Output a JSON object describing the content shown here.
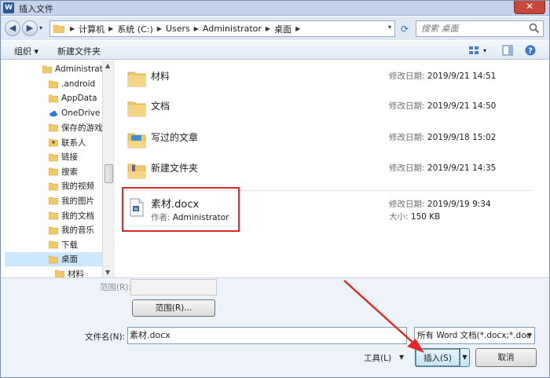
{
  "window": {
    "title": "插入文件",
    "app_icon_letter": "W",
    "close_glyph": "✕"
  },
  "address": {
    "crumbs": [
      "计算机",
      "系统 (C:)",
      "Users",
      "Administrator",
      "桌面"
    ],
    "search_placeholder": "搜索 桌面"
  },
  "toolbar": {
    "organize_label": "组织 ▾",
    "new_folder_label": "新建文件夹"
  },
  "nav": {
    "items": [
      {
        "label": "Administrato",
        "icon": "user-folder-icon"
      },
      {
        "label": ".android",
        "icon": "folder-icon"
      },
      {
        "label": "AppData",
        "icon": "folder-icon"
      },
      {
        "label": "OneDrive",
        "icon": "cloud-icon"
      },
      {
        "label": "保存的游戏",
        "icon": "folder-icon"
      },
      {
        "label": "联系人",
        "icon": "contacts-icon"
      },
      {
        "label": "链接",
        "icon": "folder-icon"
      },
      {
        "label": "搜索",
        "icon": "folder-icon"
      },
      {
        "label": "我的视频",
        "icon": "folder-icon"
      },
      {
        "label": "我的图片",
        "icon": "folder-icon"
      },
      {
        "label": "我的文档",
        "icon": "folder-icon"
      },
      {
        "label": "我的音乐",
        "icon": "folder-icon"
      },
      {
        "label": "下载",
        "icon": "folder-icon"
      },
      {
        "label": "桌面",
        "icon": "folder-icon",
        "selected": true
      },
      {
        "label": "材料",
        "icon": "folder-icon"
      }
    ]
  },
  "files": {
    "date_label": "修改日期:",
    "author_label": "作者:",
    "size_label": "大小:",
    "rows": [
      {
        "name": "材料",
        "date": "2019/9/21 14:51"
      },
      {
        "name": "文档",
        "date": "2019/9/21 14:50"
      },
      {
        "name": "写过的文章",
        "date": "2019/9/18 15:02"
      },
      {
        "name": "新建文件夹",
        "date": "2019/9/21 14:35"
      }
    ],
    "docx": {
      "name": "素材.docx",
      "author": "Administrator",
      "date": "2019/9/19 9:34",
      "size": "150 KB"
    }
  },
  "bottom": {
    "range_label": "范围(R):",
    "range_button": "范围(R)...",
    "filename_label": "文件名(N):",
    "filename_value": "素材.docx",
    "filetype_value": "所有 Word 文档(*.docx;*.doc",
    "tools_label": "工具(L)",
    "insert_label": "插入(S)",
    "cancel_label": "取消"
  },
  "colors": {
    "highlight": "#e32626",
    "folder": "#f1c86a"
  }
}
